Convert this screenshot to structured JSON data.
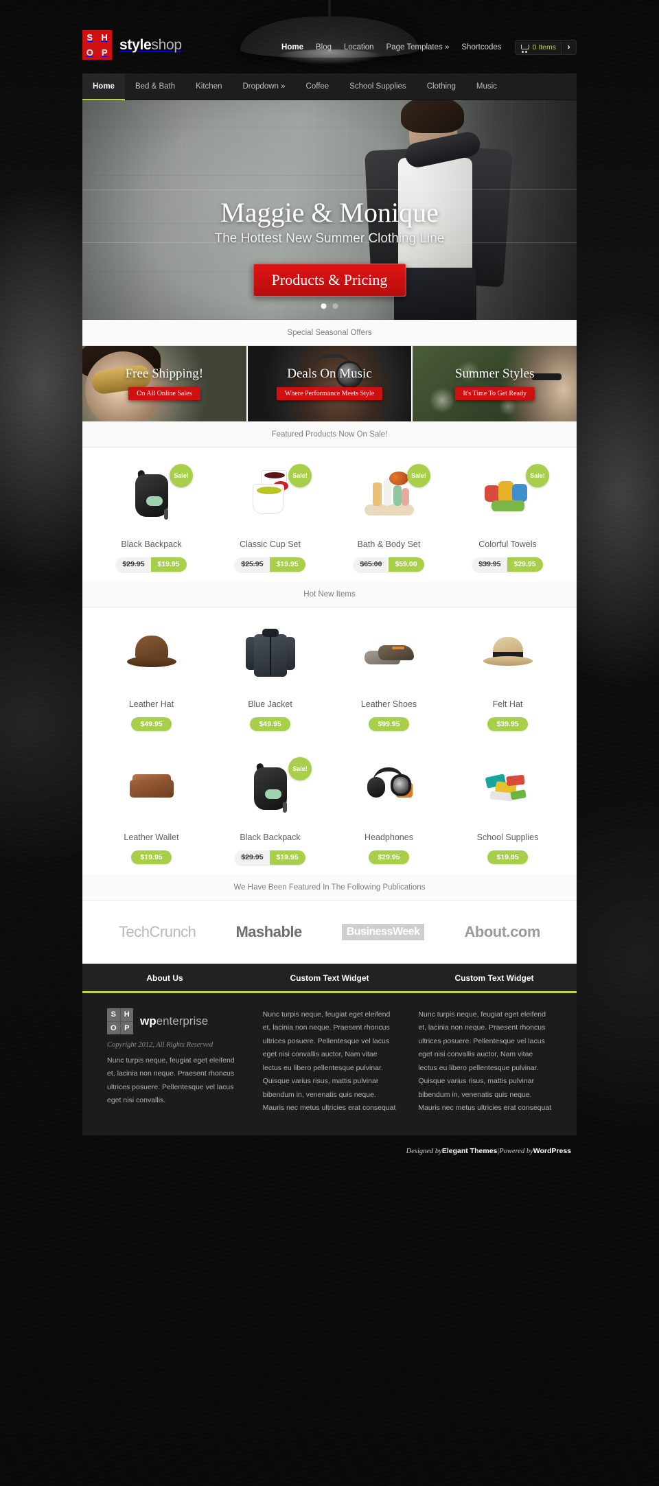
{
  "brand": {
    "mark_letters": [
      "S",
      "H",
      "O",
      "P"
    ],
    "name_bold": "style",
    "name_light": "shop"
  },
  "topnav": {
    "items": [
      {
        "label": "Home",
        "active": true
      },
      {
        "label": "Blog",
        "active": false
      },
      {
        "label": "Location",
        "active": false
      },
      {
        "label": "Page Templates »",
        "active": false
      },
      {
        "label": "Shortcodes",
        "active": false
      }
    ],
    "cart": {
      "icon": "cart-icon",
      "count_label": "0 Items",
      "arrow": "›"
    }
  },
  "subnav": {
    "items": [
      {
        "label": "Home",
        "active": true
      },
      {
        "label": "Bed & Bath",
        "active": false
      },
      {
        "label": "Kitchen",
        "active": false
      },
      {
        "label": "Dropdown »",
        "active": false
      },
      {
        "label": "Coffee",
        "active": false
      },
      {
        "label": "School Supplies",
        "active": false
      },
      {
        "label": "Clothing",
        "active": false
      },
      {
        "label": "Music",
        "active": false
      }
    ]
  },
  "hero": {
    "title": "Maggie & Monique",
    "subtitle": "The Hottest New Summer Clothing Line",
    "button_label": "Products & Pricing",
    "slides_total": 2,
    "active_slide": 1
  },
  "offers": {
    "bar_title": "Special Seasonal Offers",
    "items": [
      {
        "title": "Free Shipping!",
        "button": "On All Online Sales"
      },
      {
        "title": "Deals On Music",
        "button": "Where Performance Meets Style"
      },
      {
        "title": "Summer Styles",
        "button": "It's Time To Get Ready"
      }
    ]
  },
  "featured": {
    "bar_title": "Featured Products Now On Sale!",
    "badge_label": "Sale!",
    "products": [
      {
        "name": "Black Backpack",
        "old_price": "$29.95",
        "price": "$19.95",
        "on_sale": true,
        "art": "art-backpack"
      },
      {
        "name": "Classic Cup Set",
        "old_price": "$25.95",
        "price": "$19.95",
        "on_sale": true,
        "art": "art-cups"
      },
      {
        "name": "Bath & Body Set",
        "old_price": "$65.00",
        "price": "$59.00",
        "on_sale": true,
        "art": "art-bath"
      },
      {
        "name": "Colorful Towels",
        "old_price": "$39.95",
        "price": "$29.95",
        "on_sale": true,
        "art": "art-towels"
      }
    ]
  },
  "hot_items": {
    "bar_title": "Hot New Items",
    "row1": [
      {
        "name": "Leather Hat",
        "old_price": "",
        "price": "$49.95",
        "on_sale": false,
        "art": "art-hat"
      },
      {
        "name": "Blue Jacket",
        "old_price": "",
        "price": "$49.95",
        "on_sale": false,
        "art": "art-jacket"
      },
      {
        "name": "Leather Shoes",
        "old_price": "",
        "price": "$99.95",
        "on_sale": false,
        "art": "art-shoes"
      },
      {
        "name": "Felt Hat",
        "old_price": "",
        "price": "$39.95",
        "on_sale": false,
        "art": "art-felt"
      }
    ],
    "row2": [
      {
        "name": "Leather Wallet",
        "old_price": "",
        "price": "$19.95",
        "on_sale": false,
        "art": "art-wallet"
      },
      {
        "name": "Black Backpack",
        "old_price": "$29.95",
        "price": "$19.95",
        "on_sale": true,
        "art": "art-backpack"
      },
      {
        "name": "Headphones",
        "old_price": "",
        "price": "$29.95",
        "on_sale": false,
        "art": "art-head"
      },
      {
        "name": "School Supplies",
        "old_price": "",
        "price": "$19.95",
        "on_sale": false,
        "art": "art-school"
      }
    ]
  },
  "publications": {
    "bar_title": "We Have Been Featured In The Following Publications",
    "logos": [
      "TechCrunch",
      "Mashable",
      "BusinessWeek",
      "About.com"
    ]
  },
  "footer": {
    "columns": [
      {
        "heading": "About Us"
      },
      {
        "heading": "Custom Text Widget"
      },
      {
        "heading": "Custom Text Widget"
      }
    ],
    "wp_logo": {
      "mark_letters": [
        "S",
        "H",
        "O",
        "P"
      ],
      "name_bold": "wp",
      "name_light": "enterprise"
    },
    "copyright": "Copyright 2012, All Rights Reserved",
    "about_text": "Nunc turpis neque, feugiat eget eleifend et, lacinia non neque. Praesent rhoncus ultrices posuere. Pellentesque vel lacus eget nisi convallis.",
    "widget_text": "Nunc turpis neque, feugiat eget eleifend et, lacinia non neque. Praesent rhoncus ultrices posuere. Pellentesque vel lacus eget nisi convallis auctor, Nam vitae lectus eu libero pellentesque pulvinar. Quisque varius risus, mattis pulvinar bibendum in, venenatis quis neque. Mauris nec metus ultricies erat consequat"
  },
  "credit": {
    "designed_by": "Designed by ",
    "designer": "Elegant Themes",
    "separator": " | ",
    "powered_by": "Powered by ",
    "platform": "WordPress"
  },
  "colors": {
    "accent_red": "#cf1010",
    "accent_green": "#a8cf4a",
    "nav_underline": "#b7d44a"
  }
}
